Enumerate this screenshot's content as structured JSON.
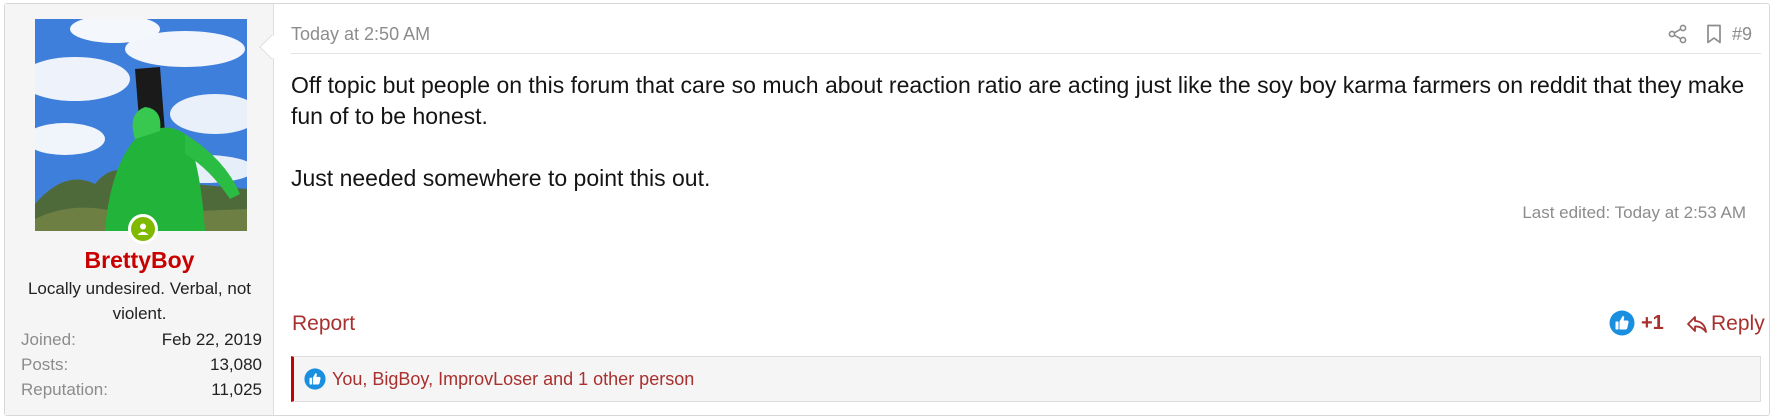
{
  "user": {
    "username": "BrettyBoy",
    "title": "Locally undesired. Verbal, not violent.",
    "stats": [
      {
        "label": "Joined:",
        "value": "Feb 22, 2019"
      },
      {
        "label": "Posts:",
        "value": "13,080"
      },
      {
        "label": "Reputation:",
        "value": "11,025"
      }
    ],
    "online": true
  },
  "post": {
    "timestamp": "Today at 2:50 AM",
    "number": "#9",
    "paragraphs": [
      "Off topic but people on this forum that care so much about reaction ratio are acting just like the soy boy karma farmers on reddit that they make fun of to be honest.",
      "Just needed somewhere to point this out."
    ],
    "last_edited": "Last edited: Today at 2:53 AM",
    "header_icons": [
      "share-icon",
      "bookmark-icon"
    ]
  },
  "actions": {
    "report": "Report",
    "like_score": "+1",
    "reply": "Reply"
  },
  "reactions": {
    "summary": "You, BigBoy, ImprovLoser and 1 other person",
    "icon": "thumbs-up-icon"
  },
  "colors": {
    "username": "#c80000",
    "link": "#a8302e",
    "muted": "#8c8c8c",
    "like_blue": "#1a8fe0",
    "online_green": "#7fb900"
  }
}
